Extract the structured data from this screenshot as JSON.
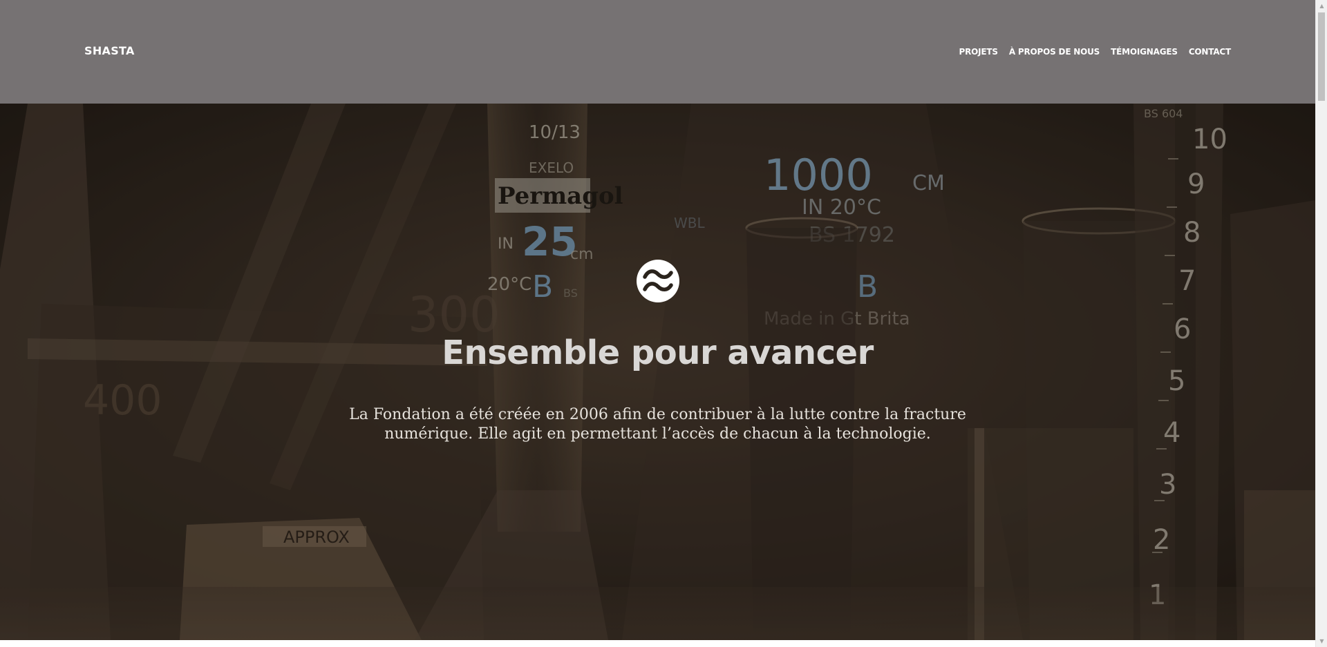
{
  "header": {
    "brand": "SHASTA",
    "nav": [
      {
        "label": "PROJETS"
      },
      {
        "label": "À PROPOS DE NOUS"
      },
      {
        "label": "TÉMOIGNAGES"
      },
      {
        "label": "CONTACT"
      }
    ],
    "background_color": "#767273"
  },
  "hero": {
    "logo_icon": "wave-circle-logo-icon",
    "title": "Ensemble pour avancer",
    "text": "La Fondation a été créée en 2006 afin de contribuer à la lutte contre la fracture numérique. Elle agit en permettant l’accès de chacun à la technologie.",
    "background_image": "laboratory-glassware-photo",
    "glassware_markings": [
      "10/13",
      "EXELO",
      "Permagold",
      "IN",
      "25",
      "cm",
      "20°C",
      "B",
      "BS",
      "1000",
      "CM",
      "IN 20°C",
      "B",
      "Made in Gt Brita",
      "400",
      "300",
      "APPROX",
      "BS 604",
      "10",
      "9",
      "8",
      "7",
      "6",
      "5",
      "4",
      "3",
      "2",
      "1"
    ]
  },
  "colors": {
    "header_bg": "#767273",
    "hero_title": "#d9d7d5",
    "hero_text": "#e6e2dc"
  },
  "scrollbar": {
    "up_icon": "scroll-up-arrow-icon",
    "down_icon": "scroll-down-arrow-icon"
  }
}
